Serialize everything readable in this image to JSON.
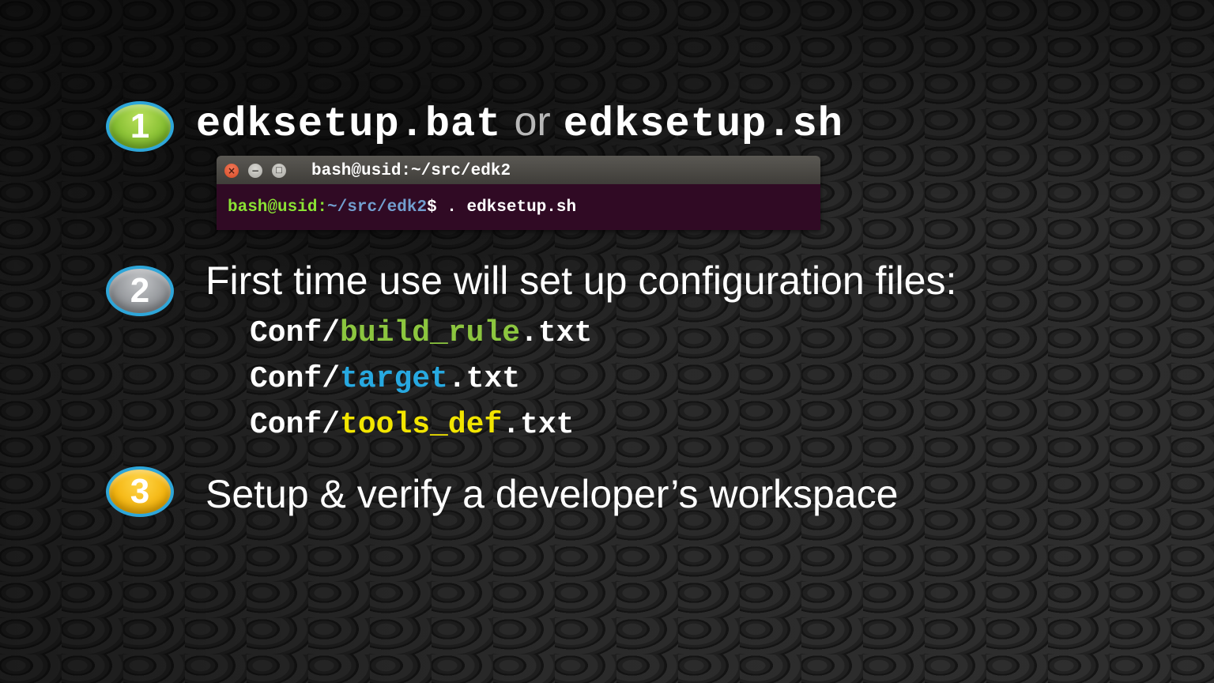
{
  "steps": [
    {
      "number": "1",
      "badge_color": "#8cc63f"
    },
    {
      "number": "2",
      "badge_color": "#9a9da1"
    },
    {
      "number": "3",
      "badge_color": "#f8b80a"
    }
  ],
  "step1": {
    "bat_script": "edksetup.bat",
    "or": "or",
    "sh_script": "edksetup.sh"
  },
  "terminal": {
    "buttons": [
      "close-icon",
      "minimize-icon",
      "maximize-icon"
    ],
    "title": "bash@usid:~/src/edk2",
    "prompt_user": "bash@usid:",
    "prompt_path": "~/src/edk2",
    "prompt_symbol": "$",
    "command": " . edksetup.sh",
    "background": "#300a24",
    "user_color": "#8ae234",
    "path_color": "#729fcf"
  },
  "step2": {
    "text": "First time use will set up configuration files:",
    "files": [
      {
        "prefix": "Conf/",
        "name": "build_rule",
        "ext": ".txt",
        "color": "#8cc63f"
      },
      {
        "prefix": "Conf/",
        "name": "target",
        "ext": ".txt",
        "color": "#27a9e1"
      },
      {
        "prefix": "Conf/",
        "name": "tools_def",
        "ext": ".txt",
        "color": "#f2e500"
      }
    ]
  },
  "step3": {
    "text": "Setup & verify a developer’s workspace"
  }
}
